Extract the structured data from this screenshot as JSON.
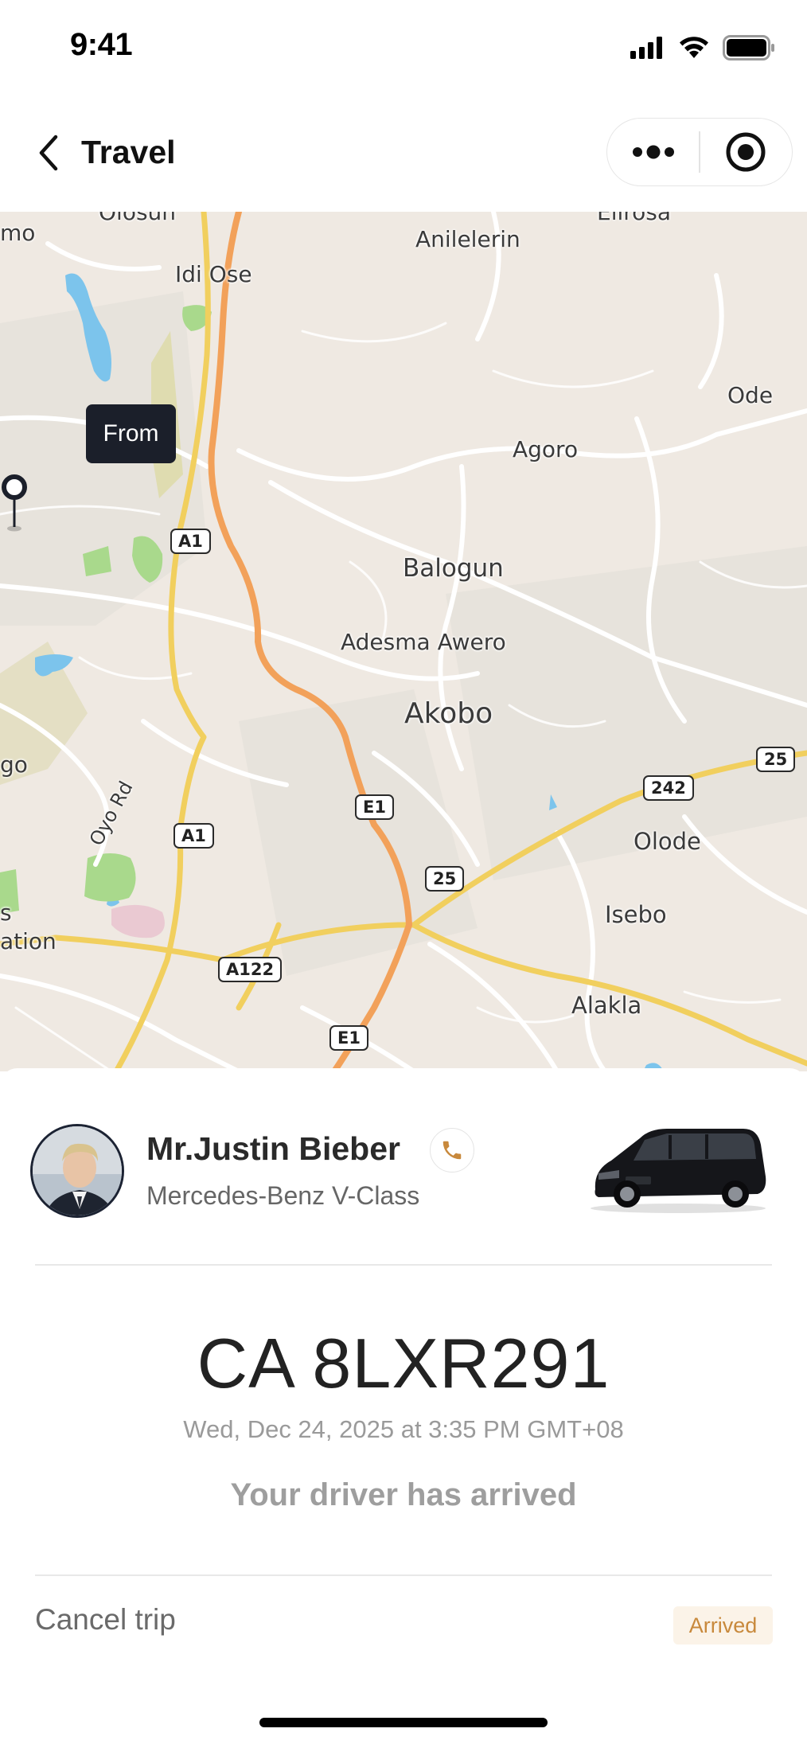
{
  "status_bar": {
    "time": "9:41",
    "icons": [
      "signal-icon",
      "wifi-icon",
      "battery-icon"
    ]
  },
  "nav": {
    "title": "Travel",
    "back_icon": "chevron-left-icon",
    "more_icon": "more-dots-icon",
    "target_icon": "target-icon"
  },
  "map": {
    "tooltip": "From",
    "places": {
      "olosun": "Olosun",
      "elirosa": "Elirosa",
      "mo": "mo",
      "anilelerin": "Anilelerin",
      "idi_ose": "Idi Ose",
      "ode": "Ode",
      "agoro": "Agoro",
      "balogun": "Balogun",
      "adesma_awero": "Adesma Awero",
      "akobo": "Akobo",
      "go": "go",
      "oyo_rd": "Oyo Rd",
      "olode": "Olode",
      "isebo": "Isebo",
      "s": "s",
      "ation": "ation",
      "alakla": "Alakla"
    },
    "roads": {
      "a1_top": "A1",
      "a1_mid": "A1",
      "e1_mid": "E1",
      "e1_bottom": "E1",
      "r25_right": "25",
      "r25_mid": "25",
      "r242": "242",
      "a122": "A122"
    },
    "colors": {
      "land": "#efe9e2",
      "water": "#7cc4ec",
      "park": "#a9d98c",
      "highway_orange": "#f2a15a",
      "highway_yellow": "#f1cf5e",
      "minor_road": "#ffffff"
    }
  },
  "driver": {
    "name": "Mr.Justin Bieber",
    "car_model": "Mercedes-Benz V-Class",
    "call_icon": "phone-icon"
  },
  "trip": {
    "plate": "CA 8LXR291",
    "datetime": "Wed, Dec 24, 2025 at 3:35 PM GMT+08",
    "status_message": "Your driver has arrived",
    "cancel_label": "Cancel trip",
    "badge": "Arrived"
  },
  "colors": {
    "accent": "#c8893c",
    "badge_bg": "#fbf3e8",
    "tooltip_bg": "#1b1f2a"
  }
}
